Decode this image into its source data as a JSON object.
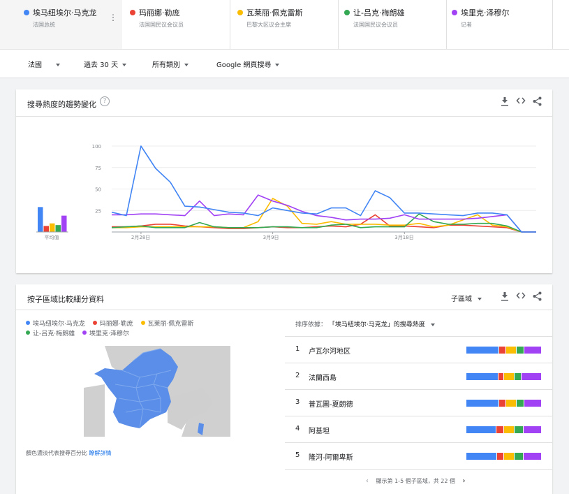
{
  "terms": [
    {
      "name": "埃马纽埃尔·马克龙",
      "sub": "法国总统",
      "color": "#4285f4"
    },
    {
      "name": "玛丽娜·勒庞",
      "sub": "法国国民议会议员",
      "color": "#ea4335"
    },
    {
      "name": "瓦莱丽·佩克雷斯",
      "sub": "巴黎大区议会主席",
      "color": "#fbbc04"
    },
    {
      "name": "让-吕克·梅朗雄",
      "sub": "法国国民议会议员",
      "color": "#34a853"
    },
    {
      "name": "埃里克·泽穆尔",
      "sub": "记者",
      "color": "#a142f4"
    }
  ],
  "filters": {
    "region": "法國",
    "time": "過去 30 天",
    "category": "所有類別",
    "search_type": "Google 網頁搜尋"
  },
  "interest_card": {
    "title": "搜尋熱度的趨勢變化",
    "help": "?",
    "avg_label": "平均值"
  },
  "chart_data": {
    "type": "line",
    "y_ticks": [
      "100",
      "75",
      "50",
      "25"
    ],
    "ylim": [
      0,
      100
    ],
    "x_tick_labels": [
      "2月28日",
      "3月9日",
      "3月18日"
    ],
    "x": [
      "2/26",
      "2/27",
      "2/28",
      "3/1",
      "3/2",
      "3/3",
      "3/4",
      "3/5",
      "3/6",
      "3/7",
      "3/8",
      "3/9",
      "3/10",
      "3/11",
      "3/12",
      "3/13",
      "3/14",
      "3/15",
      "3/16",
      "3/17",
      "3/18",
      "3/19",
      "3/20",
      "3/21",
      "3/22",
      "3/23",
      "3/24",
      "3/25",
      "3/26",
      "3/27"
    ],
    "series": [
      {
        "name": "埃马纽埃尔·马克龙",
        "color": "#4285f4",
        "values": [
          23,
          19,
          100,
          74,
          58,
          30,
          29,
          26,
          23,
          22,
          19,
          28,
          25,
          22,
          21,
          28,
          28,
          19,
          48,
          40,
          22,
          22,
          21,
          20,
          19,
          22,
          22,
          20,
          0,
          0
        ]
      },
      {
        "name": "玛丽娜·勒庞",
        "color": "#ea4335",
        "values": [
          6,
          6,
          7,
          9,
          9,
          7,
          6,
          5,
          4,
          4,
          5,
          6,
          5,
          5,
          6,
          7,
          6,
          9,
          20,
          7,
          7,
          6,
          5,
          8,
          8,
          7,
          6,
          5,
          0,
          0
        ]
      },
      {
        "name": "瓦莱丽·佩克雷斯",
        "color": "#fbbc04",
        "values": [
          5,
          5,
          6,
          6,
          6,
          6,
          6,
          6,
          5,
          5,
          12,
          39,
          30,
          10,
          9,
          12,
          9,
          9,
          9,
          8,
          8,
          10,
          6,
          8,
          14,
          20,
          8,
          6,
          0,
          0
        ]
      },
      {
        "name": "让-吕克·梅朗雄",
        "color": "#34a853",
        "values": [
          5,
          6,
          7,
          5,
          5,
          5,
          11,
          6,
          5,
          5,
          5,
          6,
          6,
          5,
          5,
          8,
          9,
          5,
          6,
          6,
          6,
          21,
          12,
          9,
          9,
          10,
          10,
          7,
          0,
          0
        ]
      },
      {
        "name": "埃里克·泽穆尔",
        "color": "#a142f4",
        "values": [
          20,
          20,
          21,
          21,
          20,
          19,
          36,
          19,
          21,
          20,
          43,
          36,
          31,
          24,
          19,
          17,
          14,
          15,
          15,
          16,
          20,
          15,
          15,
          15,
          15,
          16,
          18,
          20,
          0,
          0
        ]
      }
    ],
    "averages": [
      {
        "name": "埃马纽埃尔·马克龙",
        "value": 29
      },
      {
        "name": "玛丽娜·勒庞",
        "value": 7
      },
      {
        "name": "瓦莱丽·佩克雷斯",
        "value": 10
      },
      {
        "name": "让-吕克·梅朗雄",
        "value": 8
      },
      {
        "name": "埃里克·泽穆尔",
        "value": 19
      }
    ]
  },
  "region_card": {
    "title": "按子區域比較細分資料",
    "resolution": "子區域",
    "sort_label": "排序依據：",
    "sort_value": "「埃马纽埃尔·马克龙」的搜尋熱度",
    "map_note": "顏色濃淡代表搜尋百分比",
    "learn_more": "瞭解詳情",
    "regions": [
      {
        "rank": "1",
        "name": "卢瓦尔河地区",
        "shares": [
          45,
          8,
          14,
          10,
          23
        ]
      },
      {
        "rank": "2",
        "name": "法蘭西島",
        "shares": [
          44,
          6,
          14,
          9,
          27
        ]
      },
      {
        "rank": "3",
        "name": "普瓦圖-夏朗德",
        "shares": [
          45,
          8,
          14,
          10,
          23
        ]
      },
      {
        "rank": "4",
        "name": "阿基坦",
        "shares": [
          41,
          9,
          14,
          12,
          24
        ]
      },
      {
        "rank": "5",
        "name": "隆河-阿爾卑斯",
        "shares": [
          42,
          8,
          14,
          12,
          24
        ]
      }
    ],
    "pager": "顯示第 1-5 個子區域，共 22 個",
    "prev": "‹",
    "next": "›"
  }
}
